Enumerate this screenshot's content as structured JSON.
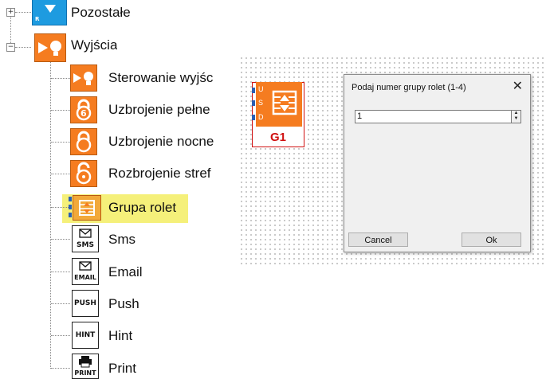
{
  "tree": {
    "top_item": "Pozostałe",
    "group": "Wyjścia",
    "items": [
      {
        "label": "Sterowanie wyjśc",
        "icon": "output-bulb-icon"
      },
      {
        "label": "Uzbrojenie pełne",
        "icon": "lock-icon"
      },
      {
        "label": "Uzbrojenie nocne",
        "icon": "lock-icon"
      },
      {
        "label": "Rozbrojenie stref",
        "icon": "unlock-icon"
      },
      {
        "label": "Grupa rolet",
        "icon": "shutter-icon"
      },
      {
        "label": "Sms",
        "icon": "sms-icon",
        "tag": "SMS"
      },
      {
        "label": "Email",
        "icon": "email-icon",
        "tag": "EMAIL"
      },
      {
        "label": "Push",
        "icon": "push-icon",
        "tag": "PUSH"
      },
      {
        "label": "Hint",
        "icon": "hint-icon",
        "tag": "HINT"
      },
      {
        "label": "Print",
        "icon": "print-icon",
        "tag": "PRINT"
      }
    ],
    "expand_sign": "+",
    "collapse_sign": "−",
    "highlight_color": "#f5f07a"
  },
  "block": {
    "pins": [
      "U",
      "S",
      "D"
    ],
    "label": "G1",
    "label_color": "#d01010",
    "accent": "#f57c20"
  },
  "dialog": {
    "title": "Podaj numer grupy rolet (1-4)",
    "close": "✕",
    "value": "1",
    "cancel_label": "Cancel",
    "ok_label": "Ok"
  }
}
